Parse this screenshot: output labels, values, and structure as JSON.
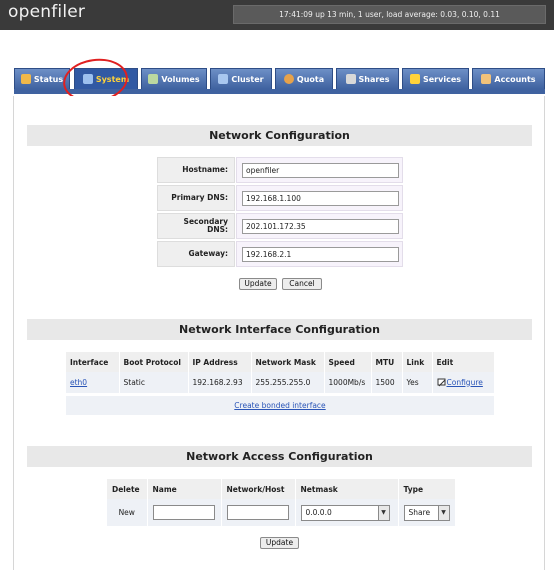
{
  "header": {
    "logo": "openfiler",
    "uptime": "17:41:09 up 13 min, 1 user, load average: 0.03, 0.10, 0.11"
  },
  "tabs": [
    {
      "label": "Status",
      "icon": "status-icon",
      "color": "#f0b84a"
    },
    {
      "label": "System",
      "icon": "system-icon",
      "color": "#9cc0ef",
      "active": true
    },
    {
      "label": "Volumes",
      "icon": "volumes-icon",
      "color": "#bcd9a0"
    },
    {
      "label": "Cluster",
      "icon": "cluster-icon",
      "color": "#a9c7ef"
    },
    {
      "label": "Quota",
      "icon": "quota-icon",
      "color": "#e7a24b"
    },
    {
      "label": "Shares",
      "icon": "shares-icon",
      "color": "#d8d8d8"
    },
    {
      "label": "Services",
      "icon": "services-icon",
      "color": "#ffd23a"
    },
    {
      "label": "Accounts",
      "icon": "accounts-icon",
      "color": "#f1c27a"
    }
  ],
  "network_config": {
    "title": "Network Configuration",
    "fields": [
      {
        "label": "Hostname:",
        "value": "openfiler"
      },
      {
        "label": "Primary DNS:",
        "value": "192.168.1.100"
      },
      {
        "label": "Secondary DNS:",
        "value": "202.101.172.35"
      },
      {
        "label": "Gateway:",
        "value": "192.168.2.1"
      }
    ],
    "update_label": "Update",
    "cancel_label": "Cancel"
  },
  "interface_config": {
    "title": "Network Interface Configuration",
    "columns": [
      "Interface",
      "Boot Protocol",
      "IP Address",
      "Network Mask",
      "Speed",
      "MTU",
      "Link",
      "Edit"
    ],
    "rows": [
      {
        "interface": "eth0",
        "boot": "Static",
        "ip": "192.168.2.93",
        "mask": "255.255.255.0",
        "speed": "1000Mb/s",
        "mtu": "1500",
        "link": "Yes",
        "edit": "Configure"
      }
    ],
    "bonded_link": "Create bonded interface"
  },
  "access_config": {
    "title": "Network Access Configuration",
    "columns": [
      "Delete",
      "Name",
      "Network/Host",
      "Netmask",
      "Type"
    ],
    "new_label": "New",
    "netmask_value": "0.0.0.0",
    "type_value": "Share",
    "update_label": "Update"
  }
}
